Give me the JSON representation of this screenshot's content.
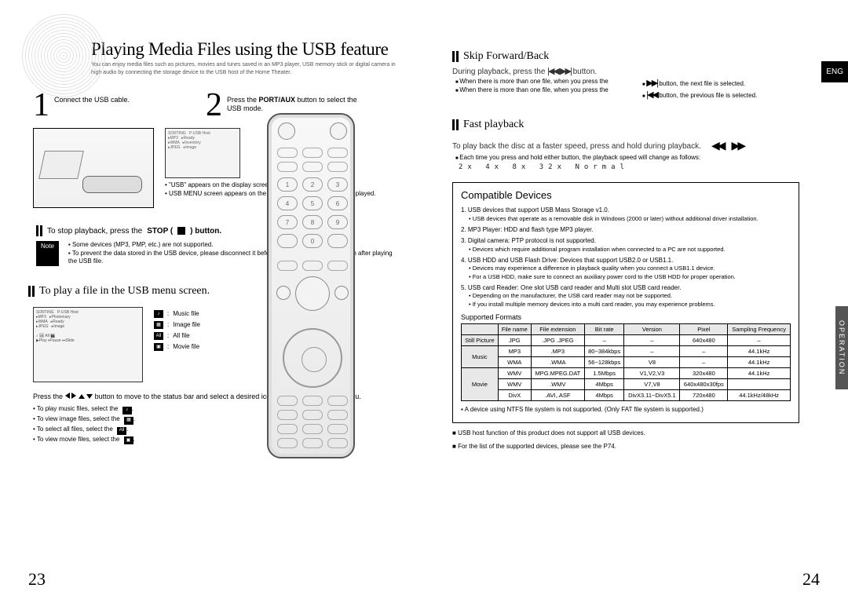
{
  "left": {
    "title": "Playing Media Files using the USB feature",
    "desc": "You can enjoy media files such as pictures, movies and tunes saved in an MP3 player, USB memory stick or digital camera in high audio by connecting the storage device to the USB host of the Home Theater.",
    "step1_num": "1",
    "step1_text": "Connect the USB cable.",
    "step2_num": "2",
    "step2_text_before": "Press the ",
    "step2_text_em": "PORT/AUX",
    "step2_text_after": " button to select the USB mode.",
    "usb_bullets": [
      "\"USB\" appears on the display screen and then disappears.",
      "USB MENU screen appears on the TV screen and the saved file is played."
    ],
    "stop_before": "To stop playback, press the ",
    "stop_em": "STOP (",
    "stop_after": ") button.",
    "notes": [
      "Some devices (MP3, PMP, etc.) are not supported.",
      "To prevent the data stored in the USB device, please disconnect it before switching to another function after playing the USB file."
    ],
    "sectionA": "To play a file in the USB menu screen.",
    "legend": {
      "music": "Music file",
      "image": "Image file",
      "all": "All file",
      "movie": "Movie file"
    },
    "arrows_text_before": "Press the ",
    "arrows_text_after": " button to move to the status bar and select a desired icon of the top part of the menu.",
    "mini_list": [
      "To play music files, select the",
      "To view image files, select the",
      "To select all files, select the",
      "To view movie files, select the"
    ],
    "page_num": "23"
  },
  "right": {
    "eng": "ENG",
    "op": "OPERATION",
    "skip_title": "Skip Forward/Back",
    "skip_inst_before": "During playback, press the ",
    "skip_inst_after": " button.",
    "skip_bullets_l": [
      "When there is more than one file, when you press the",
      "When there is more than one file, when you press the"
    ],
    "skip_bullets_r": [
      "button, the next file is selected.",
      "button, the previous file is selected."
    ],
    "fast_title": "Fast playback",
    "fast_inst": "To play back the disc at a faster speed, press and hold during playback.",
    "fast_bullet": "Each time you press and hold either button, the playback speed will change as follows:",
    "fast_vals": "2x  4x  8x  32x  Normal",
    "compat_title": "Compatible Devices",
    "clist": [
      {
        "t": "1. USB devices that support USB Mass Storage v1.0.",
        "subs": [
          "USB devices that operate as a removable disk in Windows (2000 or later) without additional driver installation."
        ]
      },
      {
        "t": "2. MP3 Player: HDD and flash type MP3 player.",
        "subs": []
      },
      {
        "t": "3. Digital camera: PTP protocol is not supported.",
        "subs": [
          "Devices which require additional program installation when connected to a PC are not supported."
        ]
      },
      {
        "t": "4. USB HDD and USB Flash Drive: Devices that support USB2.0 or USB1.1.",
        "subs": [
          "Devices may experience a difference in playback quality when you connect a USB1.1 device.",
          "For a USB HDD, make sure to connect an auxiliary power cord to the USB HDD for proper operation."
        ]
      },
      {
        "t": "5. USB card Reader: One slot USB card reader and Multi slot USB card reader.",
        "subs": [
          "Depending on the manufacturer, the USB card reader may not be supported.",
          "If you install multiple memory devices into a multi card reader, you may experience problems."
        ]
      }
    ],
    "fmt_title": "Supported Formats",
    "fmt_headers": [
      "",
      "File name",
      "File extension",
      "Bit rate",
      "Version",
      "Pixel",
      "Sampling Frequency"
    ],
    "fmt_rows": [
      {
        "h": "Still Picture",
        "cells": [
          [
            "JPG",
            ".JPG .JPEG",
            "–",
            "–",
            "640x480",
            "–"
          ]
        ]
      },
      {
        "h": "Music",
        "cells": [
          [
            "MP3",
            ".MP3",
            "80~384kbps",
            "–",
            "–",
            "44.1kHz"
          ],
          [
            "WMA",
            ".WMA",
            "56~128kbps",
            "V8",
            "–",
            "44.1kHz"
          ]
        ]
      },
      {
        "h": "Movie",
        "cells": [
          [
            "WMV",
            "MPG.MPEG.DAT",
            "1.5Mbps",
            "V1,V2,V3",
            "320x480",
            "44.1kHz"
          ],
          [
            "WMV",
            ".WMV",
            "4Mbps",
            "V7,V8",
            "640x480x30fps",
            ""
          ],
          [
            "DivX",
            ".AVI,.ASF",
            "4Mbps",
            "DivX3.11~DivX5.1",
            "720x480",
            "44.1kHz/48kHz"
          ]
        ]
      }
    ],
    "fmt_foot": "A device using NTFS file system is not supported. (Only FAT file system is supported.)",
    "foot1": "USB host function of this product does not support all USB devices.",
    "foot2": "For the list of the supported devices, please see the P74.",
    "page_num": "24"
  }
}
